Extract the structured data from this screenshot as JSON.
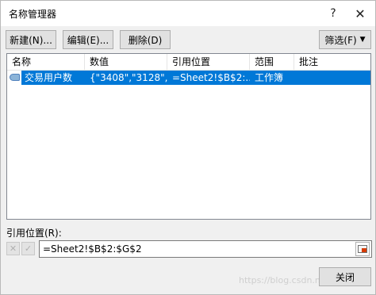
{
  "window": {
    "title": "名称管理器",
    "help_label": "?",
    "close_label": "✕"
  },
  "toolbar": {
    "new_label": "新建(N)...",
    "edit_label": "编辑(E)...",
    "delete_label": "删除(D)",
    "filter_label": "筛选(F)",
    "filter_arrow": "▼"
  },
  "list": {
    "columns": [
      "名称",
      "数值",
      "引用位置",
      "范围",
      "批注"
    ],
    "rows": [
      {
        "name": "交易用户数",
        "value": "{\"3408\",\"3128\",\"...",
        "refers_to": "=Sheet2!$B$2:...",
        "scope": "工作簿",
        "comment": ""
      }
    ]
  },
  "refers_to": {
    "label": "引用位置(R):",
    "value": "=Sheet2!$B$2:$G$2"
  },
  "footer": {
    "close_label": "关闭",
    "watermark": "https://blog.csdn.net/..."
  },
  "icons": {
    "row_icon": "name-range-icon",
    "cancel": "cancel-x-icon",
    "confirm": "confirm-check-icon",
    "collapse": "collapse-dialog-icon"
  },
  "colors": {
    "selection": "#0078d7"
  }
}
